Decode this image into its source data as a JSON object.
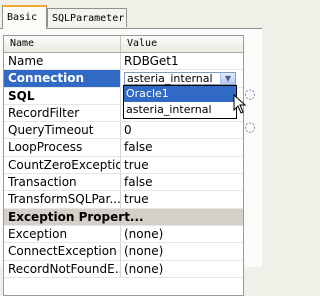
{
  "tabs": [
    {
      "label": "Basic"
    },
    {
      "label": "SQLParameter"
    }
  ],
  "grid": {
    "columns": [
      "Name",
      "Value"
    ],
    "rows": [
      {
        "name": "Name",
        "value": "RDBGet1"
      },
      {
        "name": "Connection",
        "value": "asteria_internal"
      },
      {
        "name": "SQL",
        "value": ""
      },
      {
        "name": "RecordFilter",
        "value": ""
      },
      {
        "name": "QueryTimeout",
        "value": "0"
      },
      {
        "name": "LoopProcess",
        "value": "false"
      },
      {
        "name": "CountZeroException",
        "value": "true"
      },
      {
        "name": "Transaction",
        "value": "false"
      },
      {
        "name": "TransformSQLPar...",
        "value": "true"
      },
      {
        "name": "Exception Propert...",
        "value": ""
      },
      {
        "name": "Exception",
        "value": "(none)"
      },
      {
        "name": "ConnectException",
        "value": "(none)"
      },
      {
        "name": "RecordNotFoundE...",
        "value": "(none)"
      }
    ]
  },
  "dropdown": {
    "options": [
      "Oracle1",
      "asteria_internal"
    ]
  },
  "icons": {
    "combo_arrow": "chevron-down-icon",
    "browse": "ellipsis-icon",
    "cursor": "mouse-pointer-icon"
  }
}
